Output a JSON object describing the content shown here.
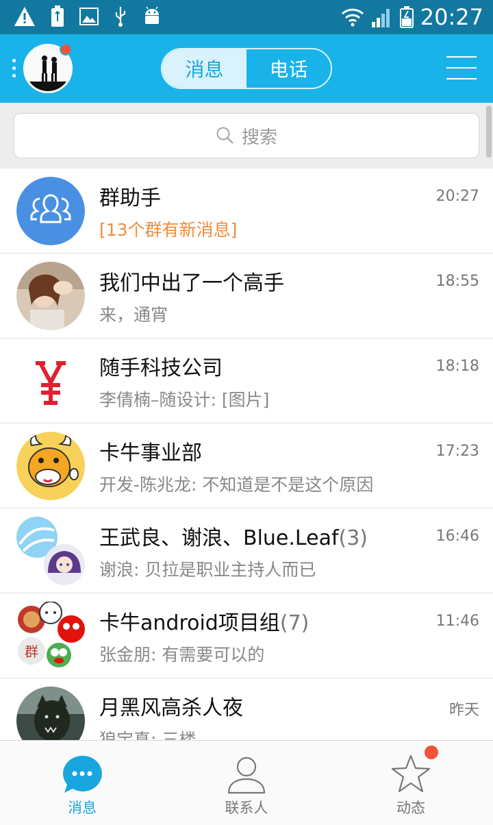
{
  "status_bar": {
    "time": "20:27",
    "left_icons": [
      "warning-icon",
      "usb-battery-icon",
      "image-icon",
      "usb-icon",
      "android-icon"
    ],
    "right_icons": [
      "wifi-icon",
      "signal-icon",
      "battery-icon"
    ]
  },
  "header": {
    "tabs": [
      {
        "label": "消息",
        "active": true
      },
      {
        "label": "电话",
        "active": false
      }
    ]
  },
  "search": {
    "placeholder": "搜索"
  },
  "conversations": [
    {
      "name": "群助手",
      "count": "",
      "message": "[13个群有新消息]",
      "time": "20:27",
      "highlight": true,
      "avatar": "group-assistant"
    },
    {
      "name": "我们中出了一个高手",
      "count": "",
      "message": "来，通宵",
      "time": "18:55",
      "highlight": false,
      "avatar": "photo-girl"
    },
    {
      "name": "随手科技公司",
      "count": "",
      "message": "李倩楠–随设计: [图片]",
      "time": "18:18",
      "highlight": false,
      "avatar": "yen-logo"
    },
    {
      "name": "卡牛事业部",
      "count": "",
      "message": "开发-陈兆龙: 不知道是不是这个原因",
      "time": "17:23",
      "highlight": false,
      "avatar": "cow-cartoon"
    },
    {
      "name": "王武良、谢浪、Blue.Leaf",
      "count": "(3)",
      "message": "谢浪: 贝拉是职业主持人而已",
      "time": "16:46",
      "highlight": false,
      "avatar": "multi-2"
    },
    {
      "name": "卡牛android项目组",
      "count": "(7)",
      "message": "张金朋: 有需要可以的",
      "time": "11:46",
      "highlight": false,
      "avatar": "multi-4"
    },
    {
      "name": "月黑风高杀人夜",
      "count": "",
      "message": "狼宝真: 三楼",
      "time": "昨天",
      "highlight": false,
      "avatar": "werewolf"
    }
  ],
  "tabbar": {
    "items": [
      {
        "label": "消息",
        "icon": "chat-bubble-icon",
        "active": true
      },
      {
        "label": "联系人",
        "icon": "contact-icon",
        "active": false
      },
      {
        "label": "动态",
        "icon": "star-icon",
        "active": false
      }
    ]
  },
  "colors": {
    "primary": "#19b3ea",
    "status_bar": "#12789f",
    "badge": "#f0533a",
    "highlight_text": "#f08c3a"
  }
}
